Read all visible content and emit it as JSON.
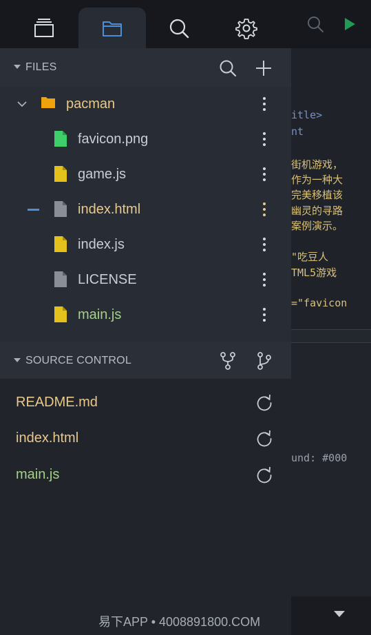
{
  "tabs": [
    {
      "name": "explorer",
      "icon": "layers-icon"
    },
    {
      "name": "files",
      "icon": "folder-icon",
      "active": true
    },
    {
      "name": "search",
      "icon": "search-icon"
    },
    {
      "name": "settings",
      "icon": "gear-icon"
    }
  ],
  "top_right": {
    "search_icon": "search-icon",
    "run_icon": "play-icon"
  },
  "editor_peek": {
    "lines": [
      "itle>",
      "nt",
      "街机游戏，",
      "作为一种大",
      "完美移植该",
      "幽灵的寻路",
      "案例演示。",
      "\"吃豆人",
      "TML5游戏",
      "=\"favicon",
      "und: #000"
    ]
  },
  "files": {
    "header": "FILES",
    "search_icon": "search-icon",
    "add_icon": "plus-icon",
    "folder": {
      "name": "pacman",
      "icon": "folder-icon"
    },
    "items": [
      {
        "name": "favicon.png",
        "icon": "file-icon",
        "color": "#3ecf6a",
        "text_color": "#c9cdd4"
      },
      {
        "name": "game.js",
        "icon": "file-icon",
        "color": "#e5c21b",
        "text_color": "#c9cdd4"
      },
      {
        "name": "index.html",
        "icon": "file-icon",
        "color": "#8a8e96",
        "text_color": "#e9c98a"
      },
      {
        "name": "index.js",
        "icon": "file-icon",
        "color": "#e5c21b",
        "text_color": "#c9cdd4"
      },
      {
        "name": "LICENSE",
        "icon": "file-icon",
        "color": "#8a8e96",
        "text_color": "#c9cdd4"
      },
      {
        "name": "main.js",
        "icon": "file-icon",
        "color": "#e5c21b",
        "text_color": "#a6cf8a"
      }
    ]
  },
  "source_control": {
    "header": "SOURCE CONTROL",
    "fork_icon": "git-fork-icon",
    "branch_icon": "git-branch-icon",
    "items": [
      {
        "name": "README.md",
        "color": "#e9c98a"
      },
      {
        "name": "index.html",
        "color": "#e9c98a"
      },
      {
        "name": "main.js",
        "color": "#a6cf8a"
      }
    ]
  },
  "watermark": "易下APP • 4008891800.COM",
  "colors": {
    "accent": "#4d8fd6",
    "folder": "#f0a30a",
    "panel": "#272c35"
  }
}
